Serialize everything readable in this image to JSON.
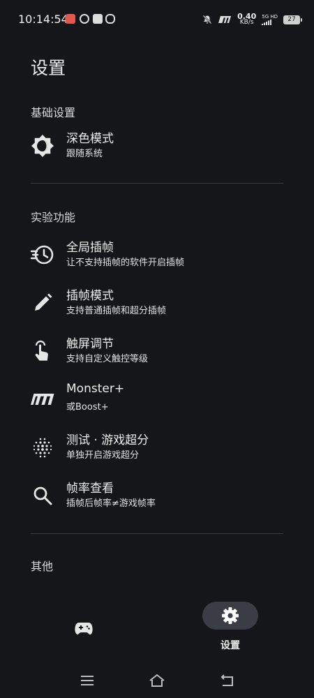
{
  "status_bar": {
    "time": "10:14:54",
    "speed_value": "0.40",
    "speed_unit": "KB/s",
    "network": "5G HD",
    "battery": "27"
  },
  "page_title": "设置",
  "sections": [
    {
      "header": "基础设置"
    },
    {
      "header": "实验功能"
    },
    {
      "header": "其他"
    }
  ],
  "items": [
    {
      "icon": "dark-mode-icon",
      "title": "深色模式",
      "subtitle": "跟随系统"
    },
    {
      "icon": "global-interpolation-icon",
      "title": "全局插帧",
      "subtitle": "让不支持插帧的软件开启插帧"
    },
    {
      "icon": "pencil-icon",
      "title": "插帧模式",
      "subtitle": "支持普通插帧和超分插帧"
    },
    {
      "icon": "touch-icon",
      "title": "触屏调节",
      "subtitle": "支持自定义触控等级"
    },
    {
      "icon": "monster-logo-icon",
      "title": "Monster+",
      "subtitle": "或Boost+"
    },
    {
      "icon": "dots-grid-icon",
      "title": "测试 · 游戏超分",
      "subtitle": "单独开启游戏超分"
    },
    {
      "icon": "search-icon",
      "title": "帧率查看",
      "subtitle": "插帧后帧率≠游戏帧率"
    }
  ],
  "bottom_nav": {
    "games_icon": "gamepad-icon",
    "settings_icon": "gear-icon",
    "settings_label": "设置"
  },
  "colors": {
    "background": "#151619",
    "pill": "#3a3d45",
    "divider": "#3a3b40",
    "text": "#ededed"
  }
}
